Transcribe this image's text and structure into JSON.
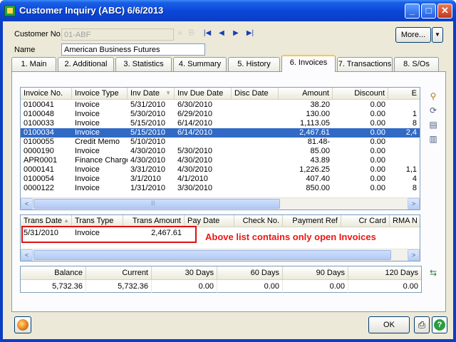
{
  "window": {
    "title": "Customer Inquiry (ABC) 6/6/2013",
    "min_glyph": "_",
    "max_glyph": "□",
    "close_glyph": "✕"
  },
  "header": {
    "customer_no_label": "Customer No.",
    "customer_no_value": "01-ABF",
    "name_label": "Name",
    "name_value": "American Business Futures",
    "more_label": "More...",
    "more_drop_glyph": "▼"
  },
  "nav_icons": {
    "first": "|◀",
    "prev": "◀",
    "next": "▶",
    "last": "▶|"
  },
  "tabs": [
    {
      "label": "1. Main"
    },
    {
      "label": "2. Additional"
    },
    {
      "label": "3. Statistics"
    },
    {
      "label": "4. Summary"
    },
    {
      "label": "5. History"
    },
    {
      "label": "6. Invoices"
    },
    {
      "label": "7. Transactions"
    },
    {
      "label": "8. S/Os"
    }
  ],
  "invoices": {
    "columns": [
      "Invoice No.",
      "Invoice Type",
      "Inv Date",
      "Inv Due Date",
      "Disc Date",
      "Amount",
      "Discount",
      "E"
    ],
    "rows": [
      {
        "no": "0100041",
        "type": "Invoice",
        "date": "5/31/2010",
        "due": "6/30/2010",
        "disc": "",
        "amount": "38.20",
        "discount": "0.00",
        "e": ""
      },
      {
        "no": "0100048",
        "type": "Invoice",
        "date": "5/30/2010",
        "due": "6/29/2010",
        "disc": "",
        "amount": "130.00",
        "discount": "0.00",
        "e": "1"
      },
      {
        "no": "0100033",
        "type": "Invoice",
        "date": "5/15/2010",
        "due": "6/14/2010",
        "disc": "",
        "amount": "1,113.05",
        "discount": "0.00",
        "e": "8"
      },
      {
        "no": "0100034",
        "type": "Invoice",
        "date": "5/15/2010",
        "due": "6/14/2010",
        "disc": "",
        "amount": "2,467.61",
        "discount": "0.00",
        "e": "2,4"
      },
      {
        "no": "0100055",
        "type": "Credit Memo",
        "date": "5/10/2010",
        "due": "",
        "disc": "",
        "amount": "81.48-",
        "discount": "0.00",
        "e": ""
      },
      {
        "no": "0000190",
        "type": "Invoice",
        "date": "4/30/2010",
        "due": "5/30/2010",
        "disc": "",
        "amount": "85.00",
        "discount": "0.00",
        "e": ""
      },
      {
        "no": "APR0001",
        "type": "Finance Charge",
        "date": "4/30/2010",
        "due": "4/30/2010",
        "disc": "",
        "amount": "43.89",
        "discount": "0.00",
        "e": ""
      },
      {
        "no": "0000141",
        "type": "Invoice",
        "date": "3/31/2010",
        "due": "4/30/2010",
        "disc": "",
        "amount": "1,226.25",
        "discount": "0.00",
        "e": "1,1"
      },
      {
        "no": "0100054",
        "type": "Invoice",
        "date": "3/1/2010",
        "due": "4/1/2010",
        "disc": "",
        "amount": "407.40",
        "discount": "0.00",
        "e": "4"
      },
      {
        "no": "0000122",
        "type": "Invoice",
        "date": "1/31/2010",
        "due": "3/30/2010",
        "disc": "",
        "amount": "850.00",
        "discount": "0.00",
        "e": "8"
      }
    ]
  },
  "transactions": {
    "columns": [
      "Trans Date",
      "Trans Type",
      "Trans Amount",
      "Pay Date",
      "Check No.",
      "Payment Ref",
      "Cr Card",
      "RMA N"
    ],
    "rows": [
      {
        "date": "5/31/2010",
        "type": "Invoice",
        "amount": "2,467.61"
      }
    ]
  },
  "annotation": "Above list contains only open Invoices",
  "aging": {
    "headers": [
      "Balance",
      "Current",
      "30 Days",
      "60 Days",
      "90 Days",
      "120 Days"
    ],
    "values": [
      "5,732.36",
      "5,732.36",
      "0.00",
      "0.00",
      "0.00",
      "0.00"
    ]
  },
  "footer": {
    "ok_label": "OK"
  },
  "scroll_glyphs": {
    "left": "<",
    "right": ">",
    "grip": "|||"
  }
}
